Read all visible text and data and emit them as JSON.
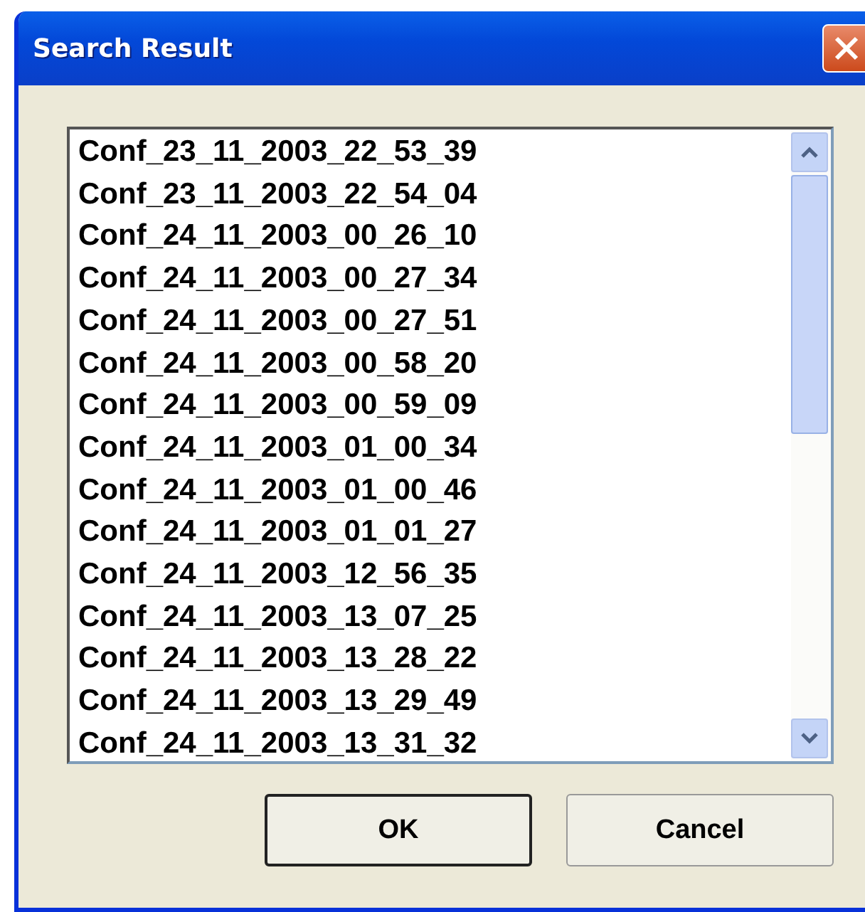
{
  "window": {
    "title": "Search Result"
  },
  "results": [
    "Conf_23_11_2003_22_53_39",
    "Conf_23_11_2003_22_54_04",
    "Conf_24_11_2003_00_26_10",
    "Conf_24_11_2003_00_27_34",
    "Conf_24_11_2003_00_27_51",
    "Conf_24_11_2003_00_58_20",
    "Conf_24_11_2003_00_59_09",
    "Conf_24_11_2003_01_00_34",
    "Conf_24_11_2003_01_00_46",
    "Conf_24_11_2003_01_01_27",
    "Conf_24_11_2003_12_56_35",
    "Conf_24_11_2003_13_07_25",
    "Conf_24_11_2003_13_28_22",
    "Conf_24_11_2003_13_29_49",
    "Conf_24_11_2003_13_31_32"
  ],
  "buttons": [
    {
      "label": "OK",
      "default": true
    },
    {
      "label": "Cancel",
      "default": false
    }
  ]
}
